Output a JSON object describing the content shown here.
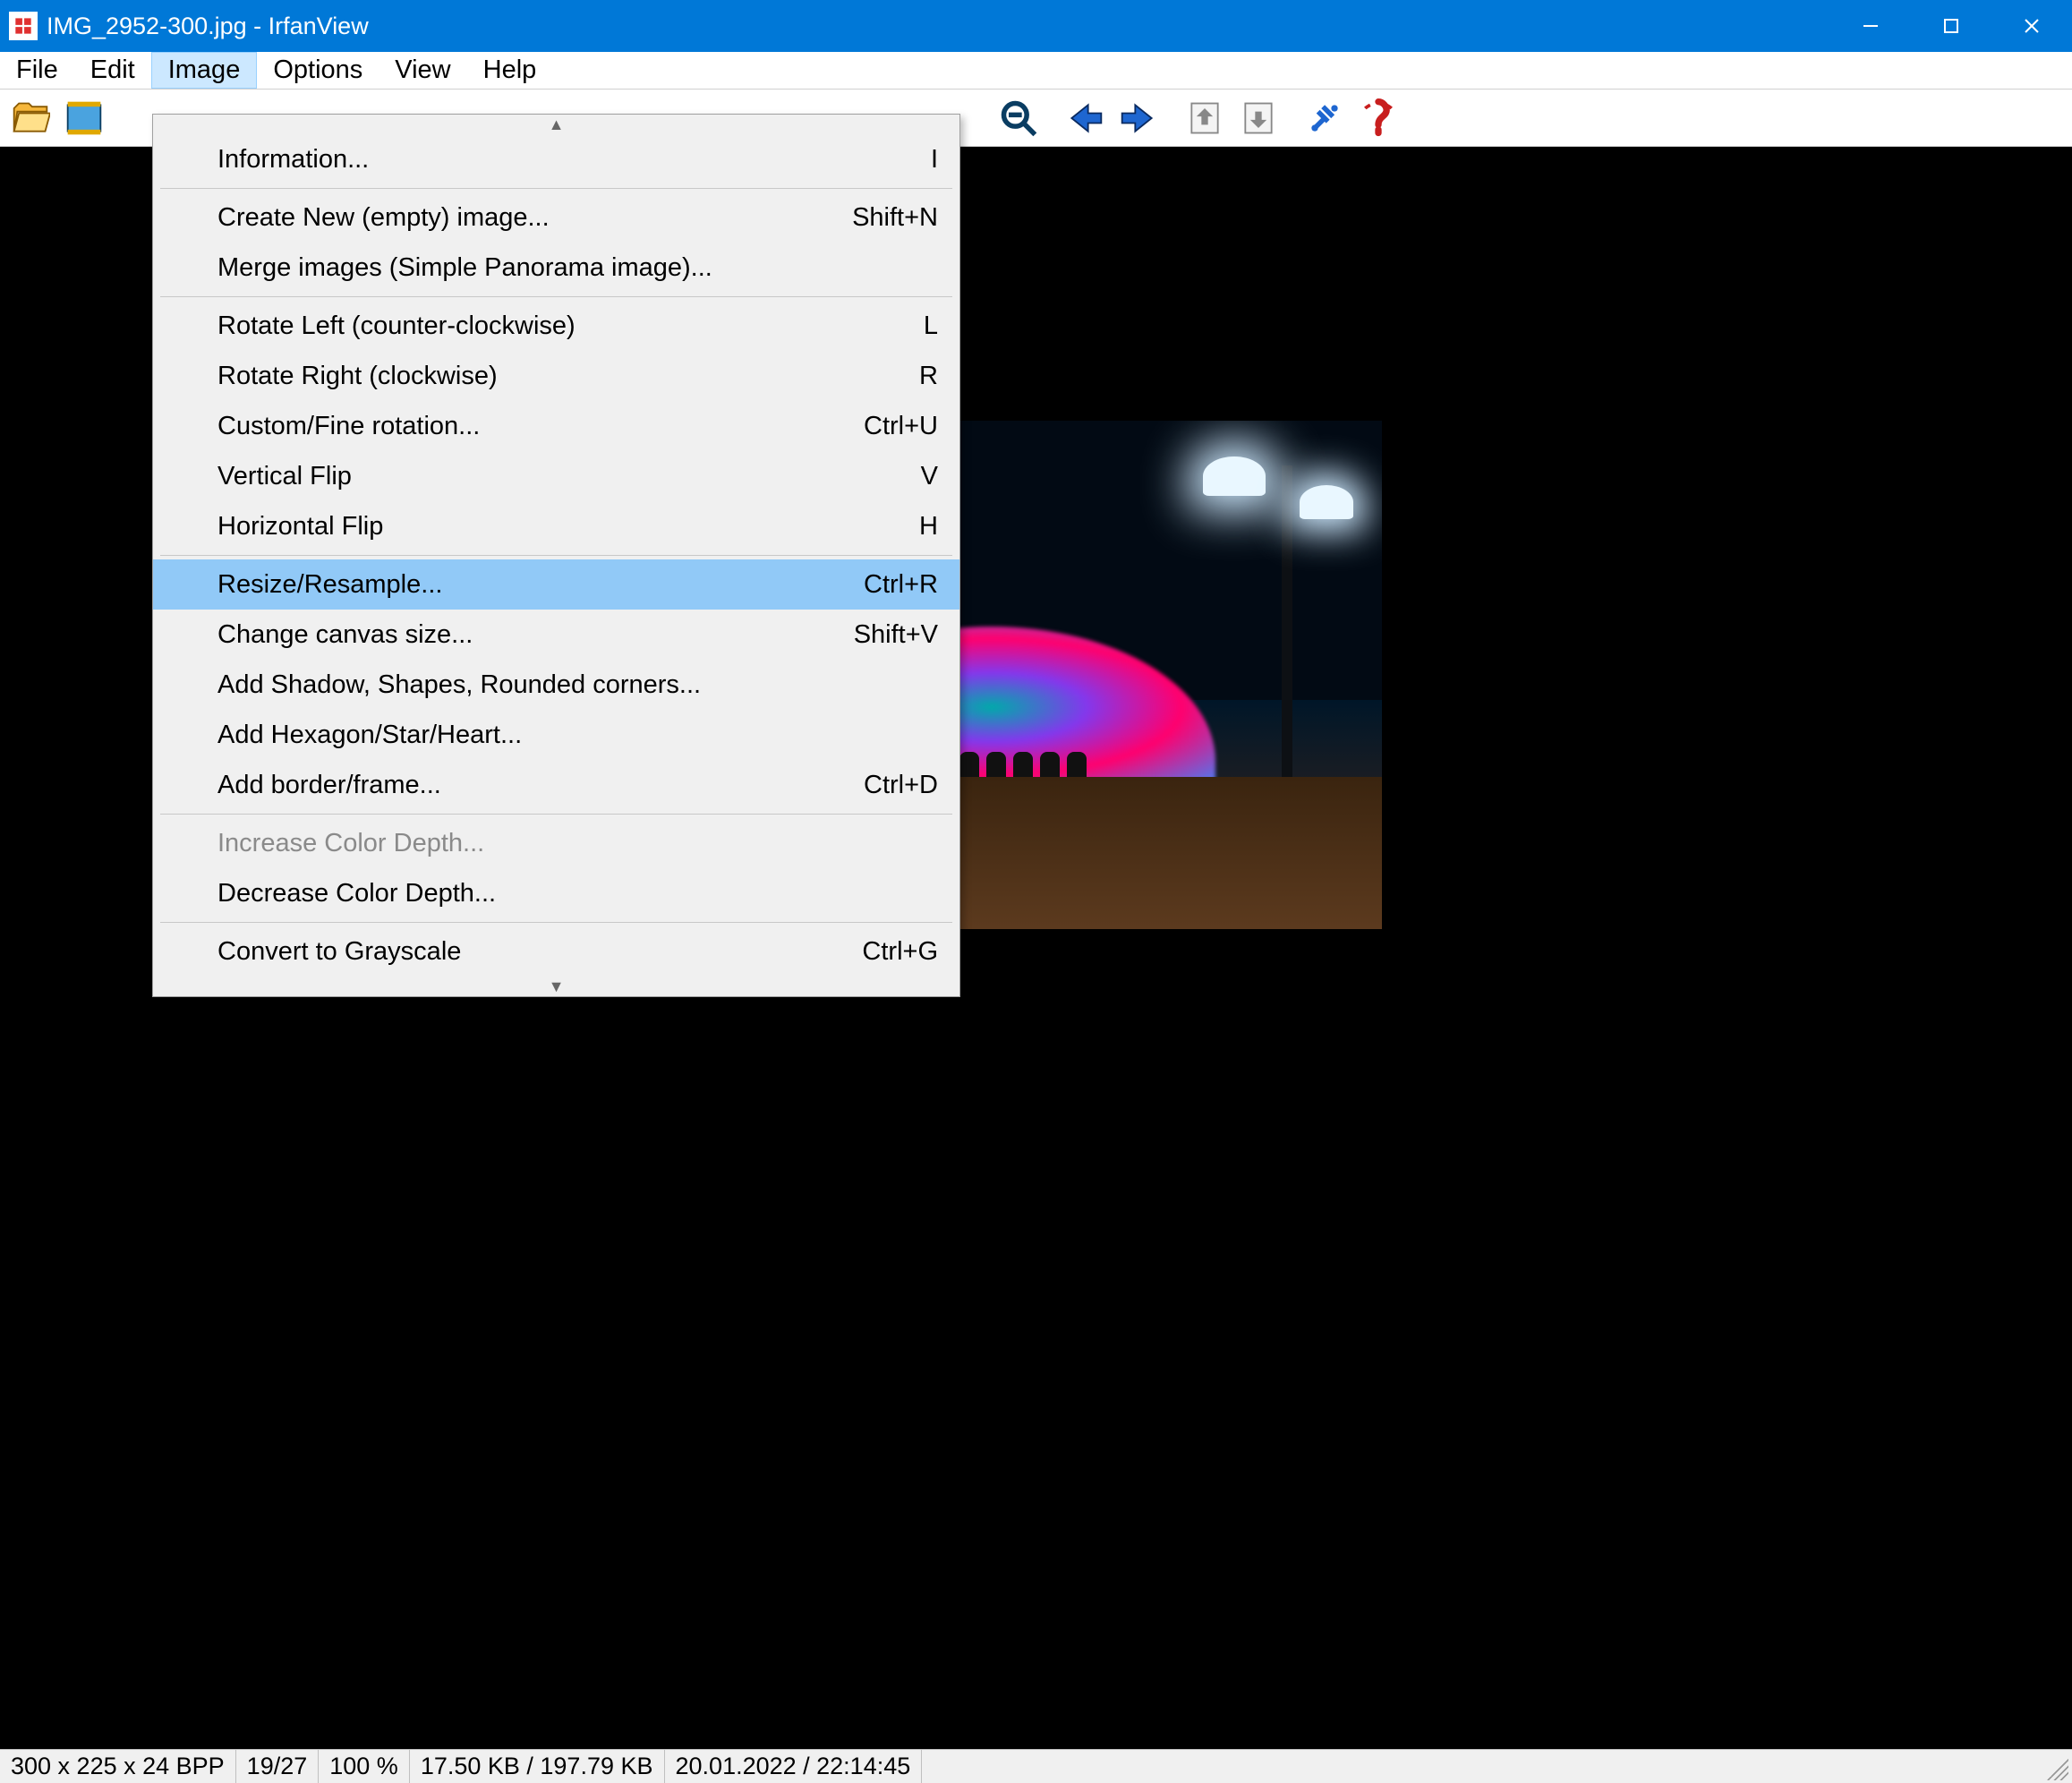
{
  "title": "IMG_2952-300.jpg - IrfanView",
  "menubar": {
    "file": "File",
    "edit": "Edit",
    "image": "Image",
    "options": "Options",
    "view": "View",
    "help": "Help"
  },
  "dropdown": {
    "information": {
      "label": "Information...",
      "shortcut": "I"
    },
    "create_new": {
      "label": "Create New (empty) image...",
      "shortcut": "Shift+N"
    },
    "merge": {
      "label": "Merge images (Simple Panorama image)...",
      "shortcut": ""
    },
    "rotate_left": {
      "label": "Rotate Left (counter-clockwise)",
      "shortcut": "L"
    },
    "rotate_right": {
      "label": "Rotate Right (clockwise)",
      "shortcut": "R"
    },
    "custom_rotation": {
      "label": "Custom/Fine rotation...",
      "shortcut": "Ctrl+U"
    },
    "vflip": {
      "label": "Vertical Flip",
      "shortcut": "V"
    },
    "hflip": {
      "label": "Horizontal Flip",
      "shortcut": "H"
    },
    "resize": {
      "label": "Resize/Resample...",
      "shortcut": "Ctrl+R"
    },
    "canvas": {
      "label": "Change canvas size...",
      "shortcut": "Shift+V"
    },
    "shadow": {
      "label": "Add Shadow, Shapes, Rounded corners...",
      "shortcut": ""
    },
    "hexagon": {
      "label": "Add Hexagon/Star/Heart...",
      "shortcut": ""
    },
    "border": {
      "label": "Add border/frame...",
      "shortcut": "Ctrl+D"
    },
    "inc_depth": {
      "label": "Increase Color Depth...",
      "shortcut": ""
    },
    "dec_depth": {
      "label": "Decrease Color Depth...",
      "shortcut": ""
    },
    "grayscale": {
      "label": "Convert to Grayscale",
      "shortcut": "Ctrl+G"
    }
  },
  "statusbar": {
    "dims": "300 x 225 x 24 BPP",
    "index": "19/27",
    "zoom": "100 %",
    "size": "17.50 KB / 197.79 KB",
    "datetime": "20.01.2022 / 22:14:45"
  }
}
